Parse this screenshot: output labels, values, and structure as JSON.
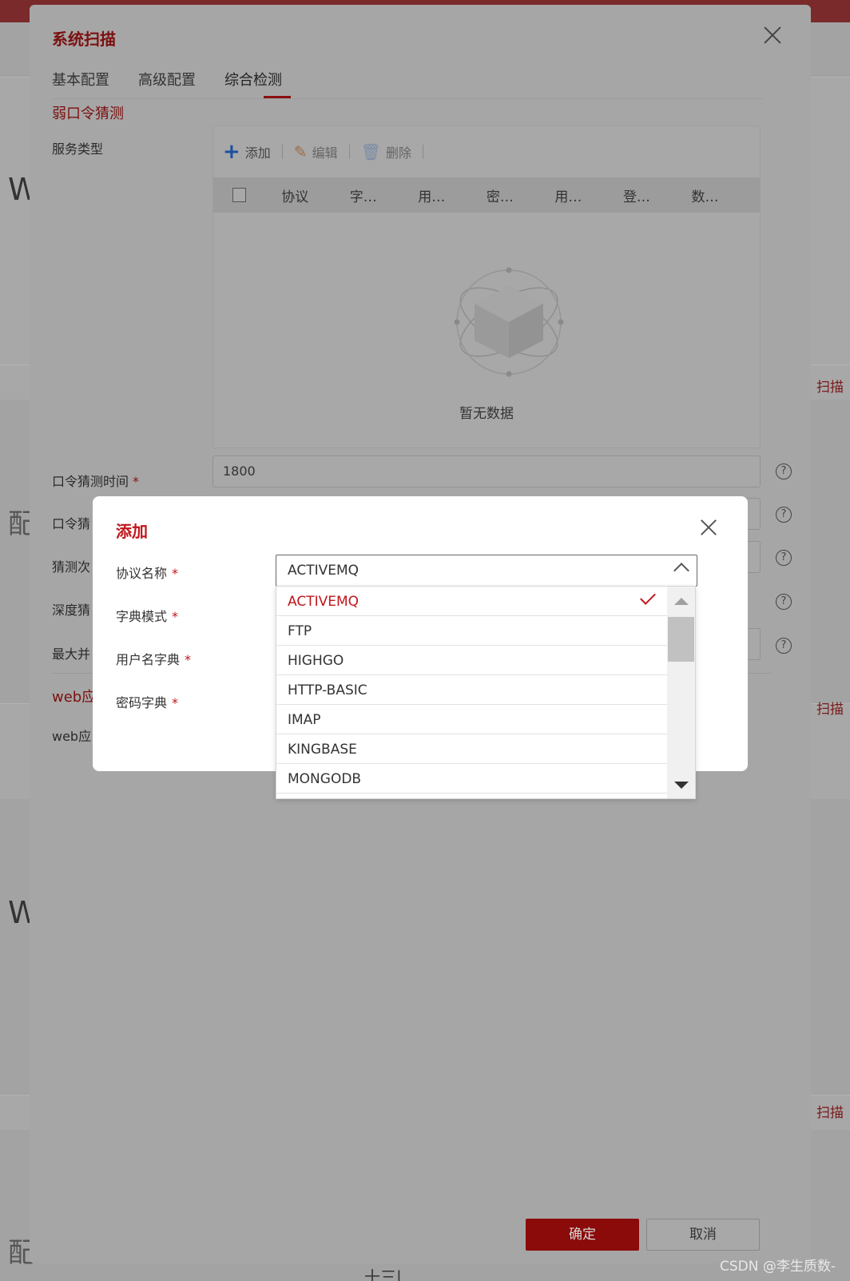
{
  "background": {
    "letters": [
      "W",
      "配",
      "W",
      "配"
    ],
    "right_link": "扫描",
    "bottom_fragment": "十三|"
  },
  "main_dialog": {
    "title": "系统扫描",
    "tabs": [
      {
        "label": "基本配置",
        "active": false
      },
      {
        "label": "高级配置",
        "active": false
      },
      {
        "label": "综合检测",
        "active": true
      }
    ],
    "section_title": "弱口令猜测",
    "service_type_label": "服务类型",
    "toolbar": {
      "add": "添加",
      "edit": "编辑",
      "delete": "删除"
    },
    "table_headers": [
      "协议",
      "字…",
      "用…",
      "密…",
      "用…",
      "登…",
      "数…"
    ],
    "empty_text": "暂无数据",
    "fields": [
      {
        "label": "口令猜测时间",
        "value": "1800"
      },
      {
        "label": "口令猜",
        "value": ""
      },
      {
        "label": "猜测次",
        "value": ""
      },
      {
        "label": "深度猜",
        "value": ""
      },
      {
        "label": "最大并",
        "value": ""
      }
    ],
    "web_section_title": "web应",
    "web_label": "web应",
    "ok_label": "确定",
    "cancel_label": "取消"
  },
  "add_dialog": {
    "title": "添加",
    "labels": {
      "protocol": "协议名称",
      "dict_mode": "字典模式",
      "username_dict": "用户名字典",
      "password_dict": "密码字典"
    },
    "protocol_value": "ACTIVEMQ",
    "options": [
      "ACTIVEMQ",
      "FTP",
      "HIGHGO",
      "HTTP-BASIC",
      "IMAP",
      "KINGBASE",
      "MONGODB"
    ],
    "selected_option": "ACTIVEMQ"
  },
  "watermark": "CSDN @李生质数-",
  "colors": {
    "accent": "#c0161b",
    "ok_button": "#8b0a0a"
  }
}
